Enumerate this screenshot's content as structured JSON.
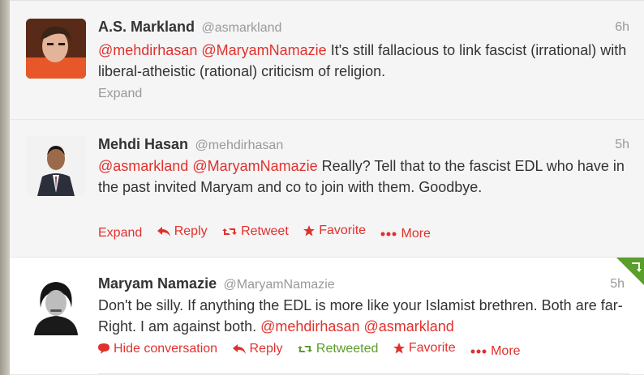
{
  "tweets": [
    {
      "fullname": "A.S. Markland",
      "username": "@asmarkland",
      "time": "6h",
      "mentions": [
        "@mehdirhasan",
        "@MaryamNamazie"
      ],
      "text": "It's still fallacious to link fascist (irrational) with liberal-atheistic (rational) criticism of religion.",
      "expand_label": "Expand"
    },
    {
      "fullname": "Mehdi Hasan",
      "username": "@mehdirhasan",
      "time": "5h",
      "mentions": [
        "@asmarkland",
        "@MaryamNamazie"
      ],
      "text": "Really? Tell that to the fascist EDL who have in the past invited Maryam and co to join with them. Goodbye.",
      "actions": {
        "expand": "Expand",
        "reply": "Reply",
        "retweet": "Retweet",
        "favorite": "Favorite",
        "more": "More"
      }
    },
    {
      "fullname": "Maryam Namazie",
      "username": "@MaryamNamazie",
      "time": "5h",
      "text": "Don't be silly. If anything the EDL is more like your Islamist brethren. Both are far-Right. I am against both.",
      "mentions": [
        "@mehdirhasan",
        "@asmarkland"
      ],
      "actions": {
        "hide_conversation": "Hide conversation",
        "reply": "Reply",
        "retweeted": "Retweeted",
        "favorite": "Favorite",
        "more": "More"
      }
    }
  ],
  "colors": {
    "link": "#e0312d",
    "retweeted": "#5a9e2c",
    "muted": "#999999",
    "text": "#333333"
  },
  "icons": [
    "reply-icon",
    "retweet-icon",
    "star-icon",
    "more-dots-icon",
    "speech-bubble-icon",
    "retweeted-corner-icon"
  ]
}
